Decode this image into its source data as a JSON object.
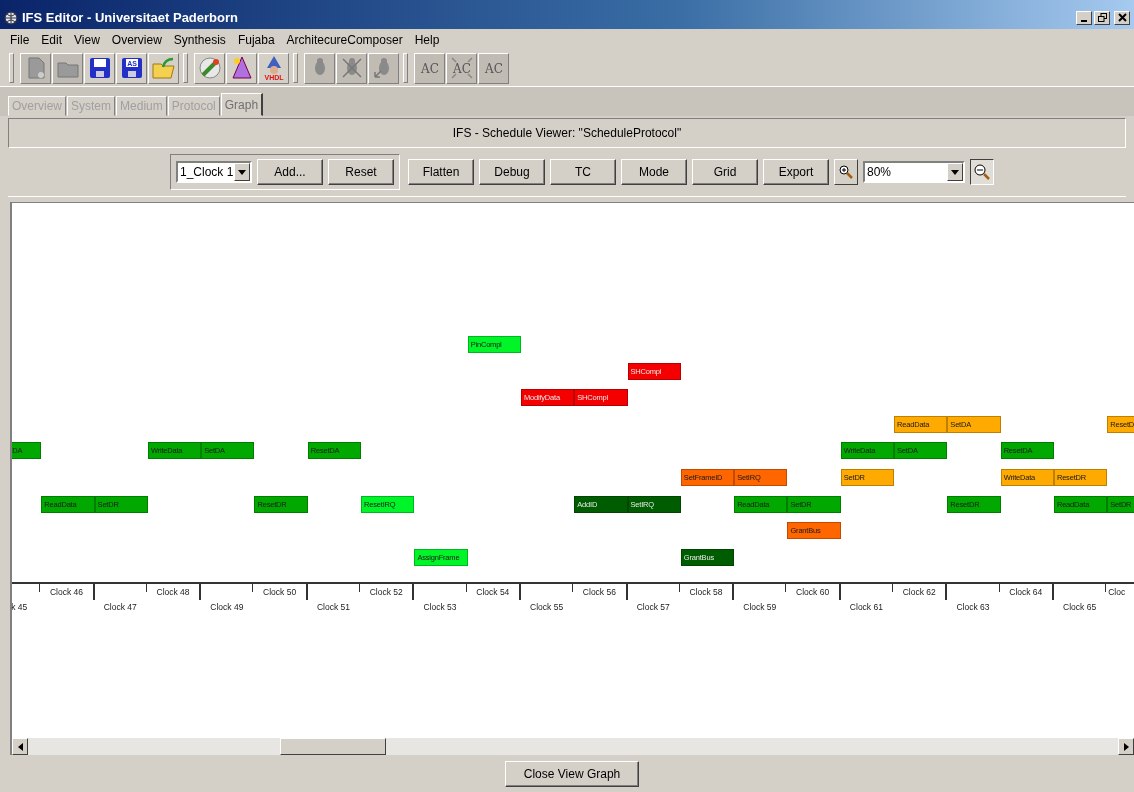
{
  "window": {
    "title": "IFS Editor - Universitaet Paderborn"
  },
  "menu": [
    "File",
    "Edit",
    "View",
    "Overview",
    "Synthesis",
    "Fujaba",
    "ArchitecureComposer",
    "Help"
  ],
  "toolbar": [
    [
      {
        "kind": "new",
        "disabled": true
      },
      {
        "kind": "open",
        "disabled": true
      },
      {
        "kind": "save",
        "disabled": false
      },
      {
        "kind": "save",
        "label": "AS",
        "disabled": false
      },
      {
        "kind": "folder",
        "disabled": false
      }
    ],
    [
      {
        "kind": "wand",
        "disabled": false
      },
      {
        "kind": "hat",
        "disabled": false
      },
      {
        "kind": "wizard",
        "label": "VHDL",
        "disabled": false
      }
    ],
    [
      {
        "kind": "bug",
        "disabled": true
      },
      {
        "kind": "bug-cross",
        "disabled": true
      },
      {
        "kind": "bug-arrow",
        "disabled": true
      }
    ],
    [
      {
        "kind": "text",
        "label": "AC",
        "disabled": true
      },
      {
        "kind": "text-cross",
        "label": "AC",
        "disabled": true
      },
      {
        "kind": "text",
        "label": "AC",
        "disabled": true
      }
    ]
  ],
  "tabs": [
    {
      "label": "Overview",
      "selected": false
    },
    {
      "label": "System",
      "selected": false
    },
    {
      "label": "Medium",
      "selected": false
    },
    {
      "label": "Protocol",
      "selected": false
    },
    {
      "label": "Graph",
      "selected": true
    }
  ],
  "header": "IFS - Schedule Viewer: \"ScheduleProtocol\"",
  "controls": {
    "clock_select": "1_Clock 1",
    "group_buttons": [
      "Add...",
      "Reset"
    ],
    "buttons": [
      "Flatten",
      "Debug",
      "TC",
      "Mode",
      "Grid",
      "Export"
    ],
    "zoom": "80%",
    "zoom_out_pressed": true
  },
  "lanes": [
    [
      {
        "kind": "gap"
      },
      {
        "kind": "gap"
      },
      {
        "kind": "gap"
      },
      {
        "kind": "gap"
      },
      {
        "kind": "gap"
      },
      {
        "kind": "gap"
      },
      {
        "kind": "gap"
      },
      {
        "kind": "gap"
      },
      {
        "kind": "gap"
      },
      {
        "kind": "task",
        "label": "PinCompl",
        "color": "#00f529"
      }
    ],
    [
      {
        "kind": "gap"
      },
      {
        "kind": "gap"
      },
      {
        "kind": "gap"
      },
      {
        "kind": "gap"
      },
      {
        "kind": "gap"
      },
      {
        "kind": "gap"
      },
      {
        "kind": "gap"
      },
      {
        "kind": "gap"
      },
      {
        "kind": "gap"
      },
      {
        "kind": "gap"
      },
      {
        "kind": "gap"
      },
      {
        "kind": "gap"
      },
      {
        "kind": "task",
        "label": "SHCompl",
        "color": "#f50000"
      }
    ],
    [
      {
        "kind": "gap"
      },
      {
        "kind": "gap"
      },
      {
        "kind": "gap"
      },
      {
        "kind": "gap"
      },
      {
        "kind": "gap"
      },
      {
        "kind": "gap"
      },
      {
        "kind": "gap"
      },
      {
        "kind": "gap"
      },
      {
        "kind": "gap"
      },
      {
        "kind": "gap"
      },
      {
        "kind": "task",
        "label": "ModifyData",
        "color": "#f50000"
      },
      {
        "kind": "task",
        "label": "SHCompl",
        "color": "#f50000"
      }
    ],
    [
      {
        "kind": "gap"
      },
      {
        "kind": "gap"
      },
      {
        "kind": "gap"
      },
      {
        "kind": "gap"
      },
      {
        "kind": "gap"
      },
      {
        "kind": "gap"
      },
      {
        "kind": "gap"
      },
      {
        "kind": "gap"
      },
      {
        "kind": "gap"
      },
      {
        "kind": "gap"
      },
      {
        "kind": "gap"
      },
      {
        "kind": "gap"
      },
      {
        "kind": "gap"
      },
      {
        "kind": "gap"
      },
      {
        "kind": "gap"
      },
      {
        "kind": "gap"
      },
      {
        "kind": "gap"
      },
      {
        "kind": "task",
        "label": "ReadData",
        "color": "#ffaa00"
      },
      {
        "kind": "task",
        "label": "SetDA",
        "color": "#ffaa00"
      },
      {
        "kind": "gap"
      },
      {
        "kind": "gap"
      },
      {
        "kind": "task",
        "label": "ResetD",
        "color": "#ffaa00"
      }
    ],
    [
      {
        "kind": "task-cut",
        "label": "DA",
        "color": "#00a800"
      },
      {
        "kind": "gap"
      },
      {
        "kind": "gap"
      },
      {
        "kind": "task",
        "label": "WriteData",
        "color": "#00a800"
      },
      {
        "kind": "task",
        "label": "SetDA",
        "color": "#00a800"
      },
      {
        "kind": "gap"
      },
      {
        "kind": "task",
        "label": "ResetDA",
        "color": "#00a800"
      },
      {
        "kind": "gap"
      },
      {
        "kind": "gap"
      },
      {
        "kind": "gap"
      },
      {
        "kind": "gap"
      },
      {
        "kind": "gap"
      },
      {
        "kind": "gap"
      },
      {
        "kind": "gap"
      },
      {
        "kind": "gap"
      },
      {
        "kind": "gap"
      },
      {
        "kind": "task",
        "label": "WriteData",
        "color": "#00a800"
      },
      {
        "kind": "task",
        "label": "SetDA",
        "color": "#00a800"
      },
      {
        "kind": "gap"
      },
      {
        "kind": "task",
        "label": "ResetDA",
        "color": "#00a800"
      }
    ],
    [
      {
        "kind": "gap"
      },
      {
        "kind": "gap"
      },
      {
        "kind": "gap"
      },
      {
        "kind": "gap"
      },
      {
        "kind": "gap"
      },
      {
        "kind": "gap"
      },
      {
        "kind": "gap"
      },
      {
        "kind": "gap"
      },
      {
        "kind": "gap"
      },
      {
        "kind": "gap"
      },
      {
        "kind": "gap"
      },
      {
        "kind": "gap"
      },
      {
        "kind": "gap"
      },
      {
        "kind": "task",
        "label": "SetFrameID",
        "color": "#ff6600"
      },
      {
        "kind": "task",
        "label": "SetIRQ",
        "color": "#ff6600"
      },
      {
        "kind": "gap"
      },
      {
        "kind": "task",
        "label": "SetDR",
        "color": "#ffaa00"
      },
      {
        "kind": "gap"
      },
      {
        "kind": "gap"
      },
      {
        "kind": "task",
        "label": "WriteData",
        "color": "#ffaa00"
      },
      {
        "kind": "task",
        "label": "ResetDR",
        "color": "#ffaa00"
      }
    ],
    [
      {
        "kind": "gap"
      },
      {
        "kind": "task",
        "label": "ReadData",
        "color": "#00a800"
      },
      {
        "kind": "task",
        "label": "SetDR",
        "color": "#00a800"
      },
      {
        "kind": "gap"
      },
      {
        "kind": "gap"
      },
      {
        "kind": "task",
        "label": "ResetDR",
        "color": "#00a800"
      },
      {
        "kind": "gap"
      },
      {
        "kind": "task",
        "label": "ResetIRQ",
        "color": "#00f529"
      },
      {
        "kind": "gap"
      },
      {
        "kind": "gap"
      },
      {
        "kind": "gap"
      },
      {
        "kind": "task",
        "label": "AddID",
        "color": "#005c00"
      },
      {
        "kind": "task",
        "label": "SetIRQ",
        "color": "#005c00"
      },
      {
        "kind": "gap"
      },
      {
        "kind": "task",
        "label": "ReadData",
        "color": "#00a800"
      },
      {
        "kind": "task",
        "label": "SetDR",
        "color": "#00a800"
      },
      {
        "kind": "gap"
      },
      {
        "kind": "gap"
      },
      {
        "kind": "task",
        "label": "ResetDR",
        "color": "#00a800"
      },
      {
        "kind": "gap"
      },
      {
        "kind": "task",
        "label": "ReadData",
        "color": "#00a800"
      },
      {
        "kind": "task",
        "label": "SetDR",
        "color": "#00a800"
      }
    ],
    [
      {
        "kind": "gap"
      },
      {
        "kind": "gap"
      },
      {
        "kind": "gap"
      },
      {
        "kind": "gap"
      },
      {
        "kind": "gap"
      },
      {
        "kind": "gap"
      },
      {
        "kind": "gap"
      },
      {
        "kind": "gap"
      },
      {
        "kind": "gap"
      },
      {
        "kind": "gap"
      },
      {
        "kind": "gap"
      },
      {
        "kind": "gap"
      },
      {
        "kind": "gap"
      },
      {
        "kind": "gap"
      },
      {
        "kind": "gap"
      },
      {
        "kind": "task",
        "label": "GrantBus",
        "color": "#ff6600"
      }
    ],
    [
      {
        "kind": "gap"
      },
      {
        "kind": "gap"
      },
      {
        "kind": "gap"
      },
      {
        "kind": "gap"
      },
      {
        "kind": "gap"
      },
      {
        "kind": "gap"
      },
      {
        "kind": "gap"
      },
      {
        "kind": "gap"
      },
      {
        "kind": "task",
        "label": "AssignFrame",
        "color": "#00f529"
      },
      {
        "kind": "gap"
      },
      {
        "kind": "gap"
      },
      {
        "kind": "gap"
      },
      {
        "kind": "gap"
      },
      {
        "kind": "task",
        "label": "GrantBus",
        "color": "#005c00"
      }
    ]
  ],
  "clocks": [
    {
      "label": "k 45",
      "kind": "cut-start"
    },
    {
      "label": "Clock 46",
      "kind": "full"
    },
    {
      "label": "Clock 47",
      "kind": "full"
    },
    {
      "label": "Clock 48",
      "kind": "full"
    },
    {
      "label": "Clock 49",
      "kind": "full"
    },
    {
      "label": "Clock 50",
      "kind": "full"
    },
    {
      "label": "Clock 51",
      "kind": "full"
    },
    {
      "label": "Clock 52",
      "kind": "full"
    },
    {
      "label": "Clock 53",
      "kind": "full"
    },
    {
      "label": "Clock 54",
      "kind": "full"
    },
    {
      "label": "Clock 55",
      "kind": "full"
    },
    {
      "label": "Clock 56",
      "kind": "full"
    },
    {
      "label": "Clock 57",
      "kind": "full"
    },
    {
      "label": "Clock 58",
      "kind": "full"
    },
    {
      "label": "Clock 59",
      "kind": "full"
    },
    {
      "label": "Clock 60",
      "kind": "full"
    },
    {
      "label": "Clock 61",
      "kind": "full"
    },
    {
      "label": "Clock 62",
      "kind": "full"
    },
    {
      "label": "Clock 63",
      "kind": "full"
    },
    {
      "label": "Clock 64",
      "kind": "full"
    },
    {
      "label": "Clock 65",
      "kind": "full"
    },
    {
      "label": "Cloc",
      "kind": "cut-end"
    }
  ],
  "close_button": "Close View Graph"
}
